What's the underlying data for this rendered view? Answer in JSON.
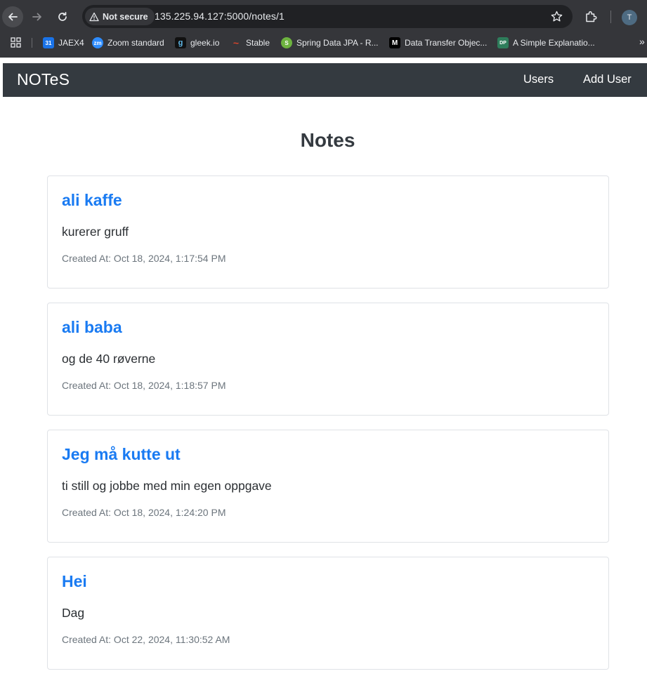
{
  "browser": {
    "security_label": "Not secure",
    "url": "135.225.94.127:5000/notes/1",
    "profile_initial": "T",
    "bookmarks": [
      {
        "label": "JAEX4",
        "icon": "calendar-icon",
        "color": "#1a73e8",
        "glyph": "31"
      },
      {
        "label": "Zoom standard",
        "icon": "zoom-icon",
        "color": "#2d8cff",
        "glyph": "zm"
      },
      {
        "label": "gleek.io",
        "icon": "gleek-icon",
        "color": "#111111",
        "glyph": "g"
      },
      {
        "label": "Stable",
        "icon": "stable-icon",
        "color": "#d9442b",
        "glyph": "~"
      },
      {
        "label": "Spring Data JPA - R...",
        "icon": "spring-icon",
        "color": "#6db33f",
        "glyph": "S"
      },
      {
        "label": "Data Transfer Objec...",
        "icon": "medium-icon",
        "color": "#000000",
        "glyph": "M"
      },
      {
        "label": "A Simple Explanatio...",
        "icon": "dp-icon",
        "color": "#2e7d5b",
        "glyph": "DP"
      }
    ]
  },
  "nav": {
    "brand": "NOTeS",
    "links": [
      "Users",
      "Add User"
    ]
  },
  "page": {
    "title": "Notes"
  },
  "notes": [
    {
      "title": "ali kaffe",
      "content": "kurerer gruff",
      "created": "Created At: Oct 18, 2024, 1:17:54 PM"
    },
    {
      "title": "ali baba",
      "content": "og de 40 røverne",
      "created": "Created At: Oct 18, 2024, 1:18:57 PM"
    },
    {
      "title": "Jeg må kutte ut",
      "content": "ti still og jobbe med min egen oppgave",
      "created": "Created At: Oct 18, 2024, 1:24:20 PM"
    },
    {
      "title": "Hei",
      "content": "Dag",
      "created": "Created At: Oct 22, 2024, 11:30:52 AM"
    }
  ],
  "colors": {
    "navbar": "#343a40",
    "link": "#1a7bf2",
    "muted": "#6c757d"
  }
}
